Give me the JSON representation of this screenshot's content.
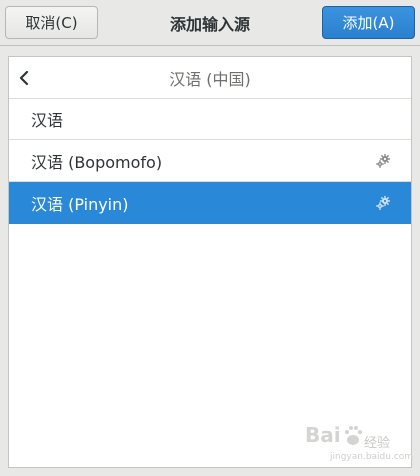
{
  "header": {
    "cancel_label": "取消(C)",
    "title": "添加输入源",
    "add_label": "添加(A)"
  },
  "list": {
    "group_title": "汉语 (中国)",
    "items": [
      {
        "label": "汉语",
        "has_settings": false,
        "selected": false
      },
      {
        "label": "汉语 (Bopomofo)",
        "has_settings": true,
        "selected": false
      },
      {
        "label": "汉语 (Pinyin)",
        "has_settings": true,
        "selected": true
      }
    ]
  },
  "watermark": {
    "brand": "Bai",
    "brand_tail": "经验",
    "sub": "jingyan.baidu.com"
  },
  "colors": {
    "accent": "#2a88d8",
    "headerbar": "#e8e8e7",
    "text": "#2e3436",
    "muted": "#6e706b"
  },
  "icons": {
    "back": "chevron-left-icon",
    "settings": "gear-icon"
  }
}
